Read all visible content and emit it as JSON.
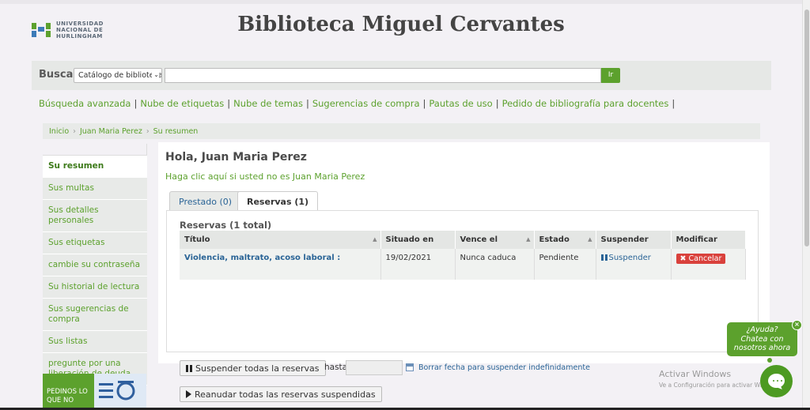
{
  "header": {
    "logo_lines": [
      "UNIVERSIDAD",
      "NACIONAL DE",
      "HURLINGHAM"
    ],
    "site_title": "Biblioteca Miguel Cervantes"
  },
  "search": {
    "label": "Buscar",
    "catalog_option": "Catálogo de biblioteca",
    "query": "",
    "go_label": "Ir"
  },
  "nav": {
    "links": [
      "Búsqueda avanzada",
      "Nube de etiquetas",
      "Nube de temas",
      "Sugerencias de compra",
      "Pautas de uso",
      "Pedido de bibliografía para docentes"
    ],
    "separator": "|"
  },
  "breadcrumb": {
    "items": [
      "Inicio",
      "Juan Maria Perez",
      "Su resumen"
    ],
    "separator": "›"
  },
  "sidebar": {
    "items": [
      "Su resumen",
      "Sus multas",
      "Sus detalles personales",
      "Sus etiquetas",
      "cambie su contraseña",
      "Su historial de lectura",
      "Sus sugerencias de compra",
      "Sus listas",
      "pregunte por una liberación de deuda"
    ]
  },
  "promo": {
    "text": "PEDINOS LO QUE NO"
  },
  "main": {
    "greeting": "Hola, Juan Maria Perez",
    "not_you": "Haga clic aquí si usted no es Juan Maria Perez",
    "tabs": [
      "Prestado (0)",
      "Reservas (1)"
    ],
    "holds_title": "Reservas (1 total)",
    "table": {
      "headers": [
        "Título",
        "Situado en",
        "Vence el",
        "Estado",
        "Suspender",
        "Modificar"
      ],
      "rows": [
        {
          "title": "Violencia, maltrato, acoso laboral :",
          "placed": "19/02/2021",
          "expires": "Nunca caduca",
          "status": "Pendiente",
          "suspend": "Suspender",
          "cancel": "Cancelar"
        }
      ]
    },
    "suspend_all": "Suspender todas la reservas",
    "until": "hasta",
    "until_value": "",
    "clear_date": "Borrar fecha para suspender indefinidamente",
    "resume_all": "Reanudar todas las reservas suspendidas"
  },
  "watermark": {
    "line1": "Activar Windows",
    "line2": "Ve a Configuración para activar Windows."
  },
  "chat": {
    "bubble_lines": [
      "¿Ayuda?",
      "Chatea con",
      "nosotros ahora"
    ],
    "close": "×"
  },
  "colors": {
    "accent_green": "#5ca12d",
    "link_blue": "#2a6496",
    "cancel_red": "#d9413c"
  }
}
